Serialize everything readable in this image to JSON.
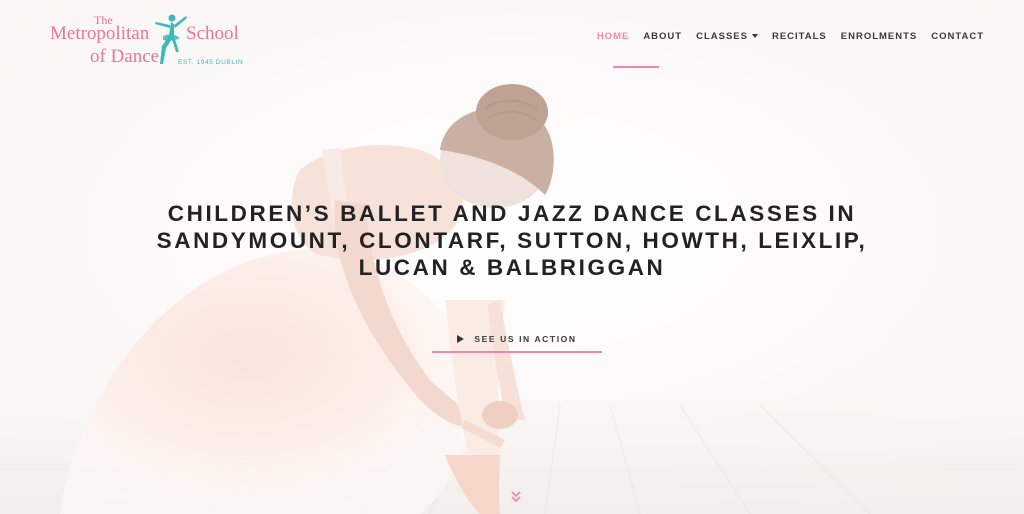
{
  "logo": {
    "the": "The",
    "metropolitan": "Metropolitan",
    "school": "School",
    "of_dance": "of Dance",
    "est": "EST. 1945 DUBLIN"
  },
  "nav": {
    "items": [
      {
        "label": "HOME",
        "active": true
      },
      {
        "label": "ABOUT",
        "active": false
      },
      {
        "label": "CLASSES",
        "active": false,
        "dropdown": true
      },
      {
        "label": "RECITALS",
        "active": false
      },
      {
        "label": "ENROLMENTS",
        "active": false
      },
      {
        "label": "CONTACT",
        "active": false
      }
    ]
  },
  "hero": {
    "headline_1": "CHILDREN’S BALLET AND JAZZ DANCE CLASSES IN",
    "headline_2": "SANDYMOUNT, CLONTARF, SUTTON, HOWTH, LEIXLIP,",
    "headline_3": "LUCAN & BALBRIGGAN",
    "cta_label": "SEE US IN ACTION",
    "cta_icon": "play-icon",
    "scroll_icon": "double-chevron-down-icon"
  },
  "colors": {
    "accent_pink": "#ec8aab",
    "logo_pink": "#e8759a",
    "logo_teal": "#3bb8b8",
    "text_dark": "#222222"
  }
}
